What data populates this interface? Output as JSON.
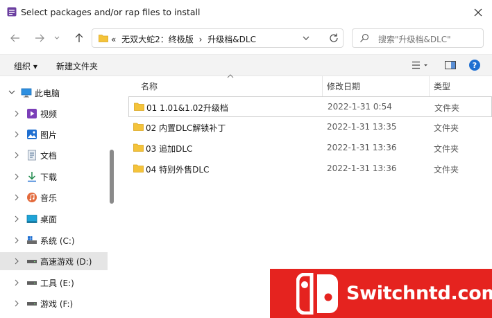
{
  "window": {
    "title": "Select packages and/or rap files to install"
  },
  "address_bar": {
    "overflow": "«",
    "crumbs": [
      "无双大蛇2：终极版",
      "升级档&DLC"
    ],
    "separator": "›"
  },
  "search": {
    "placeholder": "搜索\"升级档&DLC\""
  },
  "toolbar": {
    "organize": "组织 ▾",
    "new_folder": "新建文件夹"
  },
  "nav": {
    "items": [
      {
        "label": "此电脑",
        "icon": "computer-icon"
      },
      {
        "label": "视频",
        "icon": "video-icon"
      },
      {
        "label": "图片",
        "icon": "pictures-icon"
      },
      {
        "label": "文档",
        "icon": "documents-icon"
      },
      {
        "label": "下载",
        "icon": "download-icon"
      },
      {
        "label": "音乐",
        "icon": "music-icon"
      },
      {
        "label": "桌面",
        "icon": "desktop-icon"
      },
      {
        "label": "系统 (C:)",
        "icon": "drive-icon"
      },
      {
        "label": "高速游戏 (D:)",
        "icon": "drive-icon",
        "selected": true
      },
      {
        "label": "工具 (E:)",
        "icon": "drive-icon"
      },
      {
        "label": "游戏 (F:)",
        "icon": "drive-icon"
      }
    ]
  },
  "columns": {
    "name": "名称",
    "date": "修改日期",
    "type": "类型"
  },
  "files": [
    {
      "name": "01 1.01&1.02升级档",
      "date": "2022-1-31 0:54",
      "type": "文件夹"
    },
    {
      "name": "02 内置DLC解锁补丁",
      "date": "2022-1-31 13:35",
      "type": "文件夹"
    },
    {
      "name": "03 追加DLC",
      "date": "2022-1-31 13:36",
      "type": "文件夹"
    },
    {
      "name": "04 特别外售DLC",
      "date": "2022-1-31 13:36",
      "type": "文件夹"
    }
  ],
  "watermark": {
    "text": "Switchntd.com",
    "brand_color": "#e5231f"
  }
}
